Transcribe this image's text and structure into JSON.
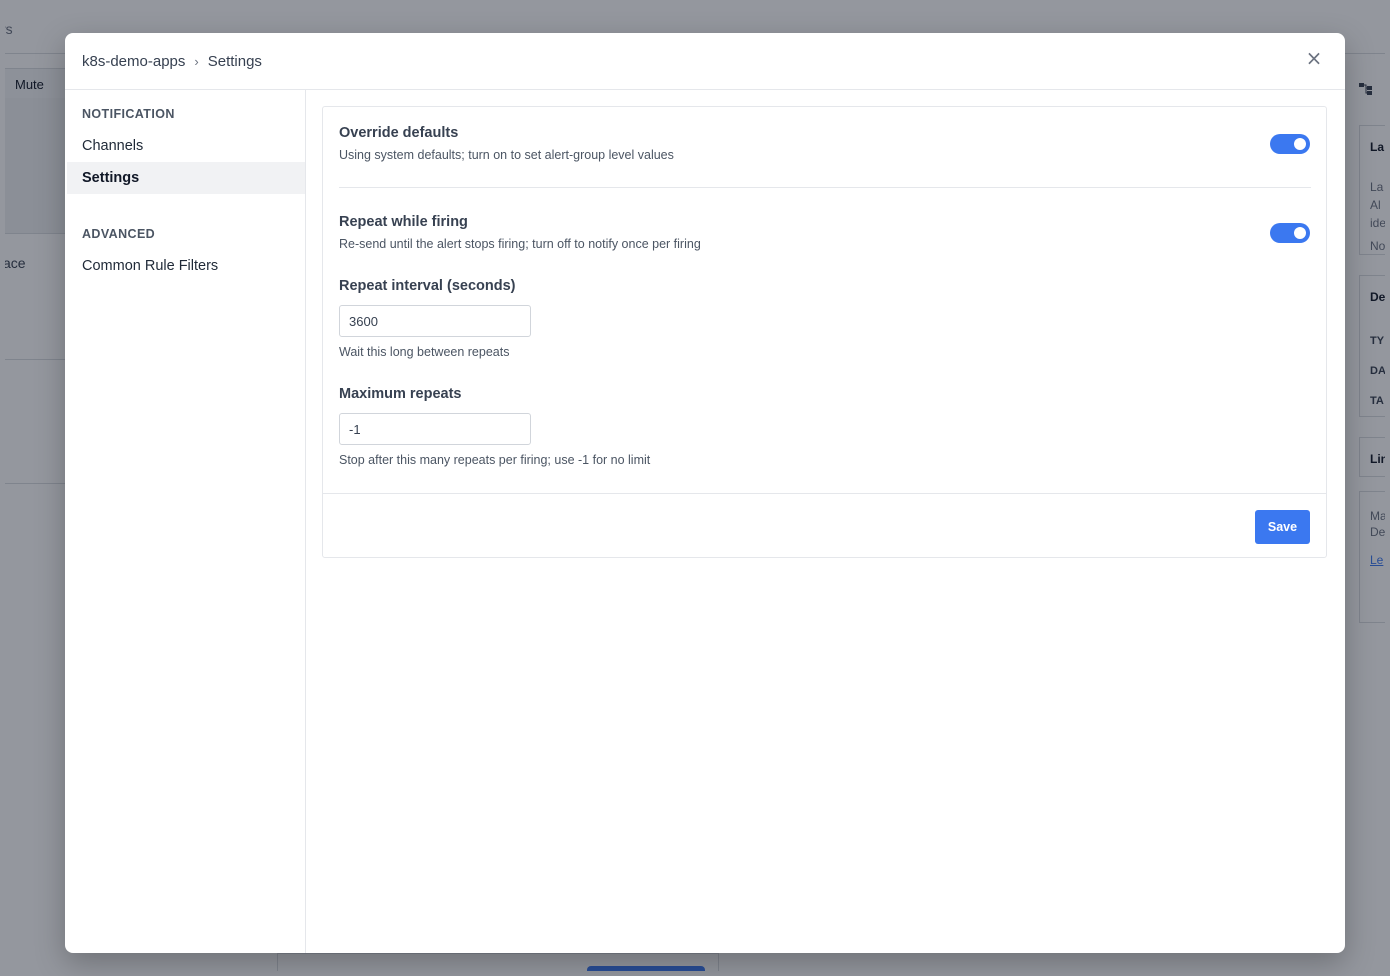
{
  "background": {
    "topbar_text": "rs",
    "mute_label": "Mute",
    "side_text": "ace",
    "right_icon": "hierarchy-icon",
    "right_cards": [
      {
        "title": "La",
        "lines": [
          "La",
          "Al",
          "ide",
          "No"
        ]
      },
      {
        "title": "De",
        "lines": [
          "TY",
          "DA",
          "TA"
        ]
      },
      {
        "title": "Lin",
        "lines": []
      },
      {
        "title": "",
        "lines": [
          "Ma",
          "De",
          "Le"
        ]
      }
    ]
  },
  "modal": {
    "breadcrumb": {
      "project": "k8s-demo-apps",
      "separator": "›",
      "current": "Settings"
    },
    "close_label": "×"
  },
  "sidebar": {
    "sections": [
      {
        "title": "NOTIFICATION",
        "items": [
          {
            "label": "Channels",
            "active": false
          },
          {
            "label": "Settings",
            "active": true
          }
        ]
      },
      {
        "title": "ADVANCED",
        "items": [
          {
            "label": "Common Rule Filters",
            "active": false
          }
        ]
      }
    ]
  },
  "settings": {
    "override": {
      "title": "Override defaults",
      "description": "Using system defaults; turn on to set alert-group level values",
      "enabled": true
    },
    "repeat": {
      "title": "Repeat while firing",
      "description": "Re-send until the alert stops firing; turn off to notify once per firing",
      "enabled": true
    },
    "repeat_interval": {
      "label": "Repeat interval (seconds)",
      "value": "3600",
      "help": "Wait this long between repeats"
    },
    "max_repeats": {
      "label": "Maximum repeats",
      "value": "-1",
      "help": "Stop after this many repeats per firing; use -1 for no limit"
    },
    "save_label": "Save"
  },
  "colors": {
    "accent": "#3b78f0",
    "overlay": "#111827"
  }
}
